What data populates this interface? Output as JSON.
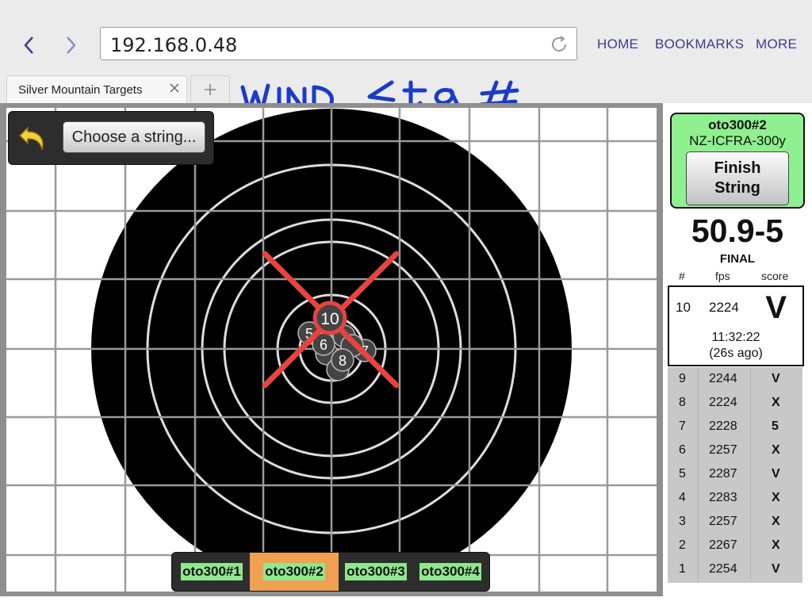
{
  "browser": {
    "url": "192.168.0.48",
    "menu": {
      "home": "HOME",
      "bookmarks": "BOOKMARKS",
      "more": "MORE"
    },
    "tab_title": "Silver Mountain Targets"
  },
  "target": {
    "choose_string_label": "Choose a string...",
    "annotation": "WIND <ta #",
    "shots": [
      {
        "label": "5"
      },
      {
        "label": "6"
      },
      {
        "label": "7"
      },
      {
        "label": "8"
      },
      {
        "label": "10"
      }
    ]
  },
  "strings": [
    {
      "label": "oto300#1",
      "active": false
    },
    {
      "label": "oto300#2",
      "active": true
    },
    {
      "label": "oto300#3",
      "active": false
    },
    {
      "label": "oto300#4",
      "active": false
    }
  ],
  "sidebar": {
    "string_name": "oto300#2",
    "rules": "NZ-ICFRA-300y",
    "finish_line1": "Finish",
    "finish_line2": "String",
    "total": "50.9-5",
    "status": "FINAL",
    "headers": {
      "num": "#",
      "fps": "fps",
      "score": "score"
    },
    "latest": {
      "num": "10",
      "fps": "2224",
      "score": "V",
      "time": "11:32:22",
      "ago": "(26s ago)"
    },
    "rows": [
      {
        "num": "9",
        "fps": "2244",
        "score": "V"
      },
      {
        "num": "8",
        "fps": "2224",
        "score": "X"
      },
      {
        "num": "7",
        "fps": "2228",
        "score": "5"
      },
      {
        "num": "6",
        "fps": "2257",
        "score": "X"
      },
      {
        "num": "5",
        "fps": "2287",
        "score": "V"
      },
      {
        "num": "4",
        "fps": "2283",
        "score": "X"
      },
      {
        "num": "3",
        "fps": "2257",
        "score": "X"
      },
      {
        "num": "2",
        "fps": "2267",
        "score": "X"
      },
      {
        "num": "1",
        "fps": "2254",
        "score": "V"
      }
    ]
  },
  "colors": {
    "accent": "#3b3b8f",
    "green": "#8ef08e",
    "active_tab": "#f0a050",
    "cross": "#e8433f",
    "ink": "#1a3cc8"
  }
}
